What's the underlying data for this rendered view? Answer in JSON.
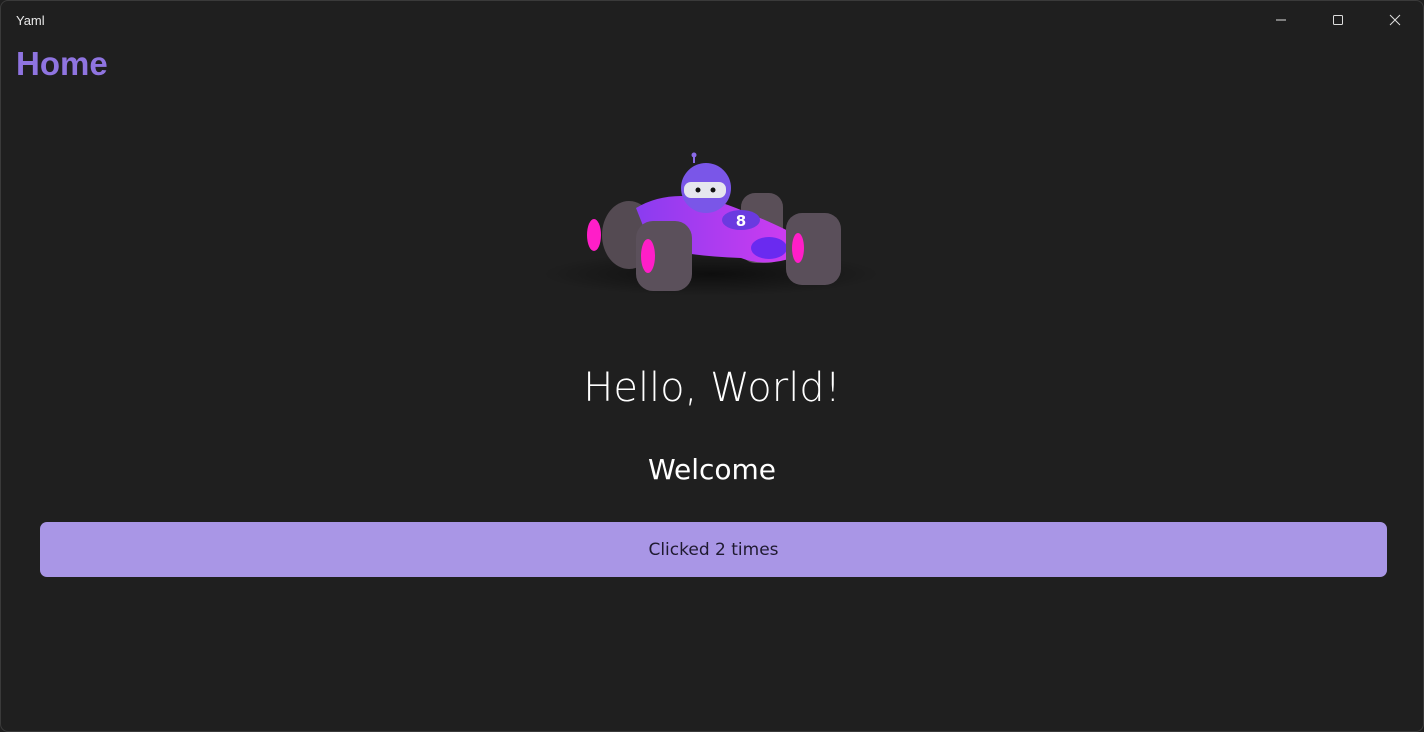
{
  "window": {
    "title": "Yaml"
  },
  "page": {
    "title": "Home",
    "heading": "Hello, World!",
    "subheading": "Welcome",
    "counter_button_label": "Clicked 2 times"
  },
  "colors": {
    "accent": "#8f74e0",
    "button_bg": "#a996e6",
    "background": "#1f1f1f"
  }
}
